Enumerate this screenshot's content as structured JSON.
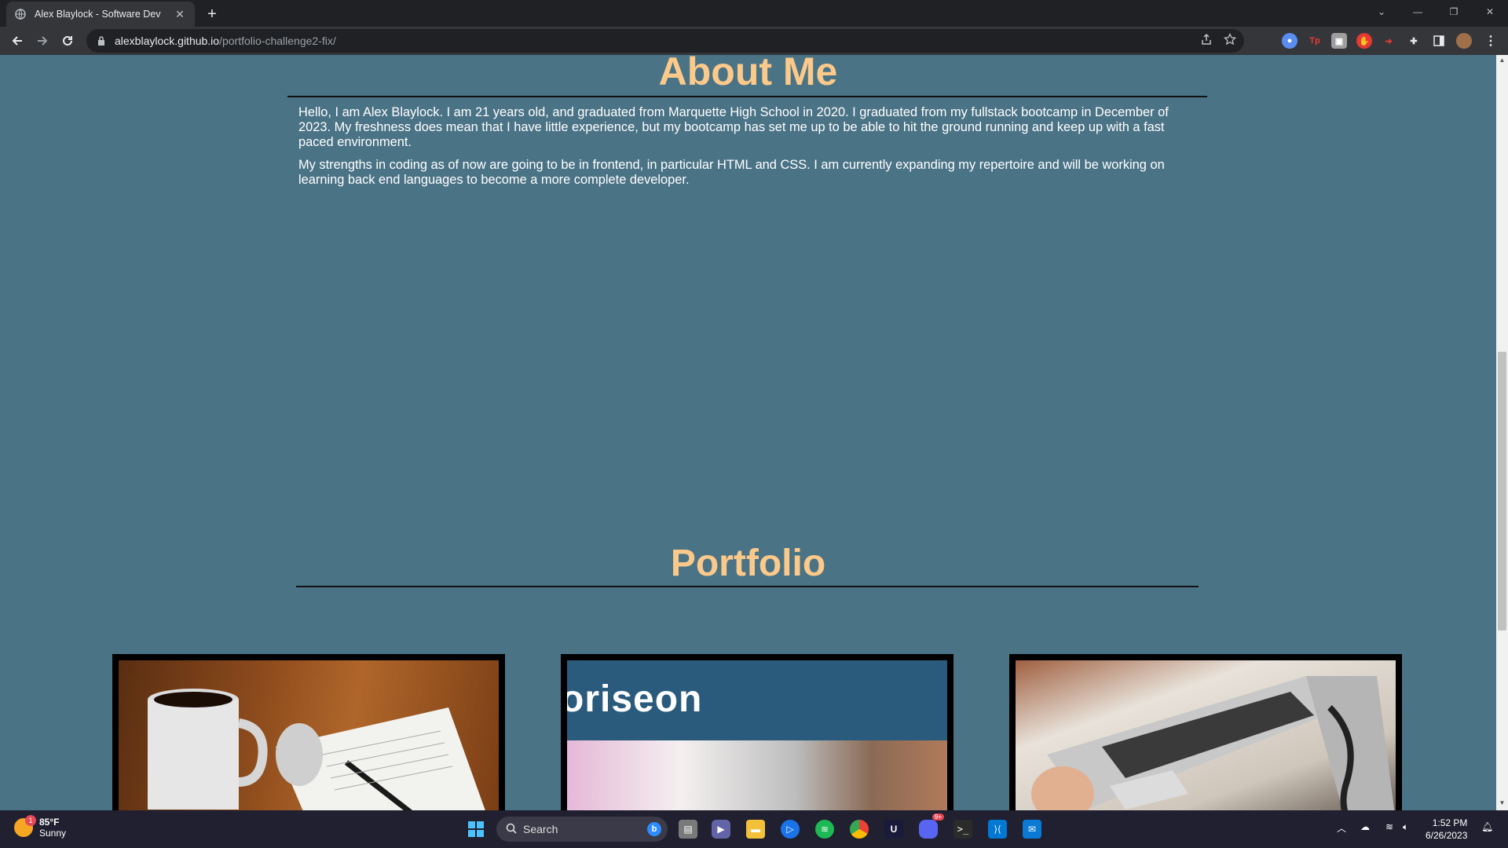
{
  "browser": {
    "tab_title": "Alex Blaylock - Software Dev",
    "tab_close": "✕",
    "new_tab": "+",
    "url_host": "alexblaylock.github.io",
    "url_path": "/portfolio-challenge2-fix/"
  },
  "page": {
    "about_title": "About Me",
    "about_paragraphs": [
      "Hello, I am Alex Blaylock. I am 21 years old, and graduated from Marquette High School in 2020. I graduated from my fullstack bootcamp in December of 2023. My freshness does mean that I have little experience, but my bootcamp has set me up to be able to hit the ground running and keep up with a fast paced environment.",
      "My strengths in coding as of now are going to be in frontend, in particular HTML and CSS. I am currently expanding my repertoire and will be working on learning back end languages to become a more complete developer."
    ],
    "portfolio_title": "Portfolio",
    "card2_logo_text": "oriseon"
  },
  "taskbar": {
    "weather_temp": "85°F",
    "weather_desc": "Sunny",
    "weather_badge": "1",
    "search_label": "Search",
    "time": "1:52 PM",
    "date": "6/26/2023",
    "discord_badge": "9+"
  },
  "colors": {
    "page_bg": "#4b7386",
    "heading": "#fbc98a"
  }
}
